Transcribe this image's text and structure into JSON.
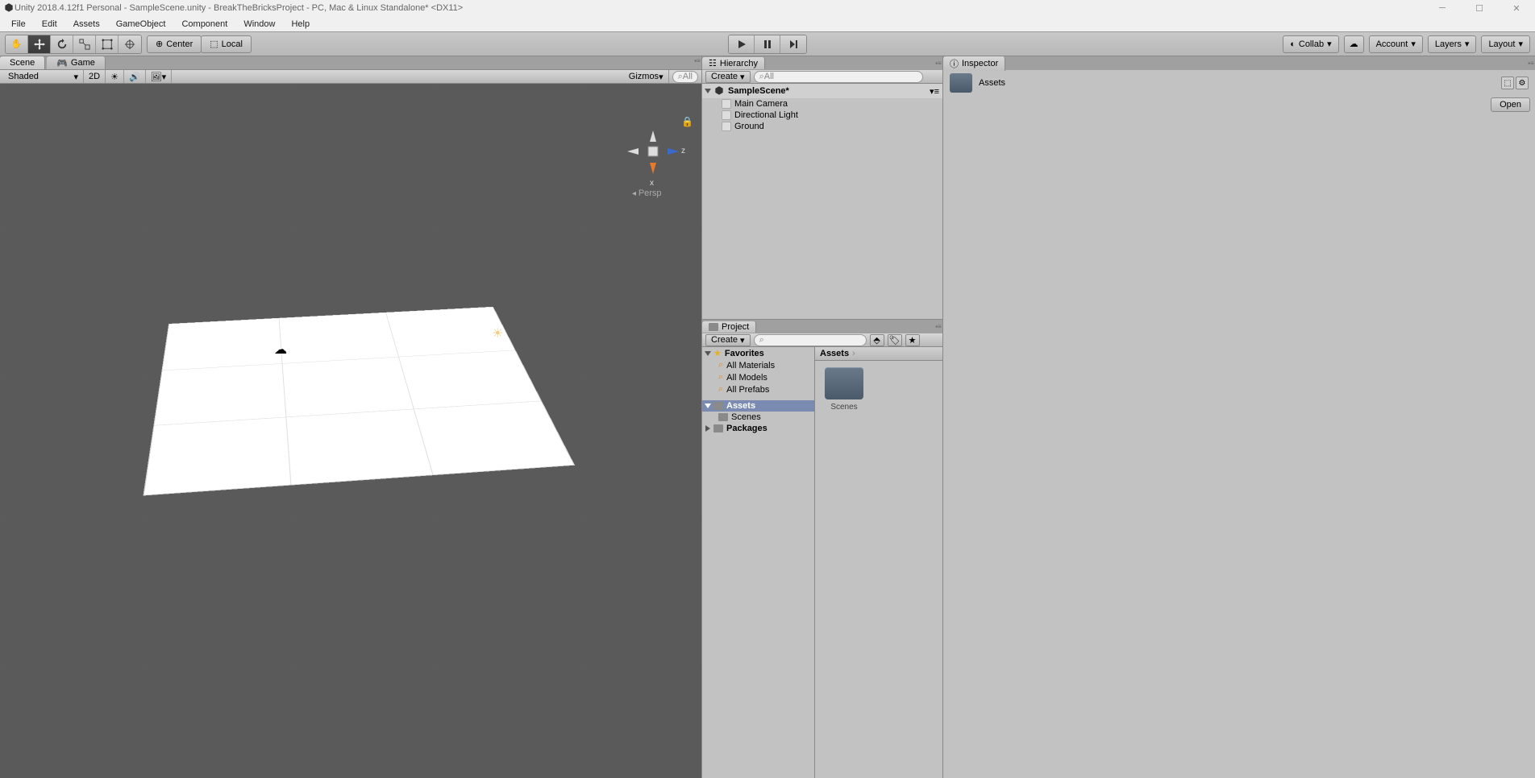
{
  "titlebar": {
    "title": "Unity 2018.4.12f1 Personal - SampleScene.unity - BreakTheBricksProject - PC, Mac & Linux Standalone* <DX11>"
  },
  "menubar": [
    "File",
    "Edit",
    "Assets",
    "GameObject",
    "Component",
    "Window",
    "Help"
  ],
  "toolbar": {
    "pivot_center": "Center",
    "pivot_local": "Local",
    "collab": "Collab",
    "account": "Account",
    "layers": "Layers",
    "layout": "Layout"
  },
  "scene": {
    "tab_scene": "Scene",
    "tab_game": "Game",
    "shading": "Shaded",
    "mode_2d": "2D",
    "gizmos": "Gizmos",
    "search_placeholder": "All",
    "axis_x": "x",
    "axis_z": "z",
    "persp": "Persp"
  },
  "hierarchy": {
    "title": "Hierarchy",
    "create": "Create",
    "search_placeholder": "All",
    "scene_name": "SampleScene*",
    "items": [
      "Main Camera",
      "Directional Light",
      "Ground"
    ]
  },
  "project": {
    "title": "Project",
    "create": "Create",
    "favorites": "Favorites",
    "fav_items": [
      "All Materials",
      "All Models",
      "All Prefabs"
    ],
    "assets": "Assets",
    "scenes": "Scenes",
    "packages": "Packages",
    "breadcrumb": "Assets",
    "folder_label": "Scenes"
  },
  "inspector": {
    "title": "Inspector",
    "selected": "Assets",
    "open": "Open"
  }
}
